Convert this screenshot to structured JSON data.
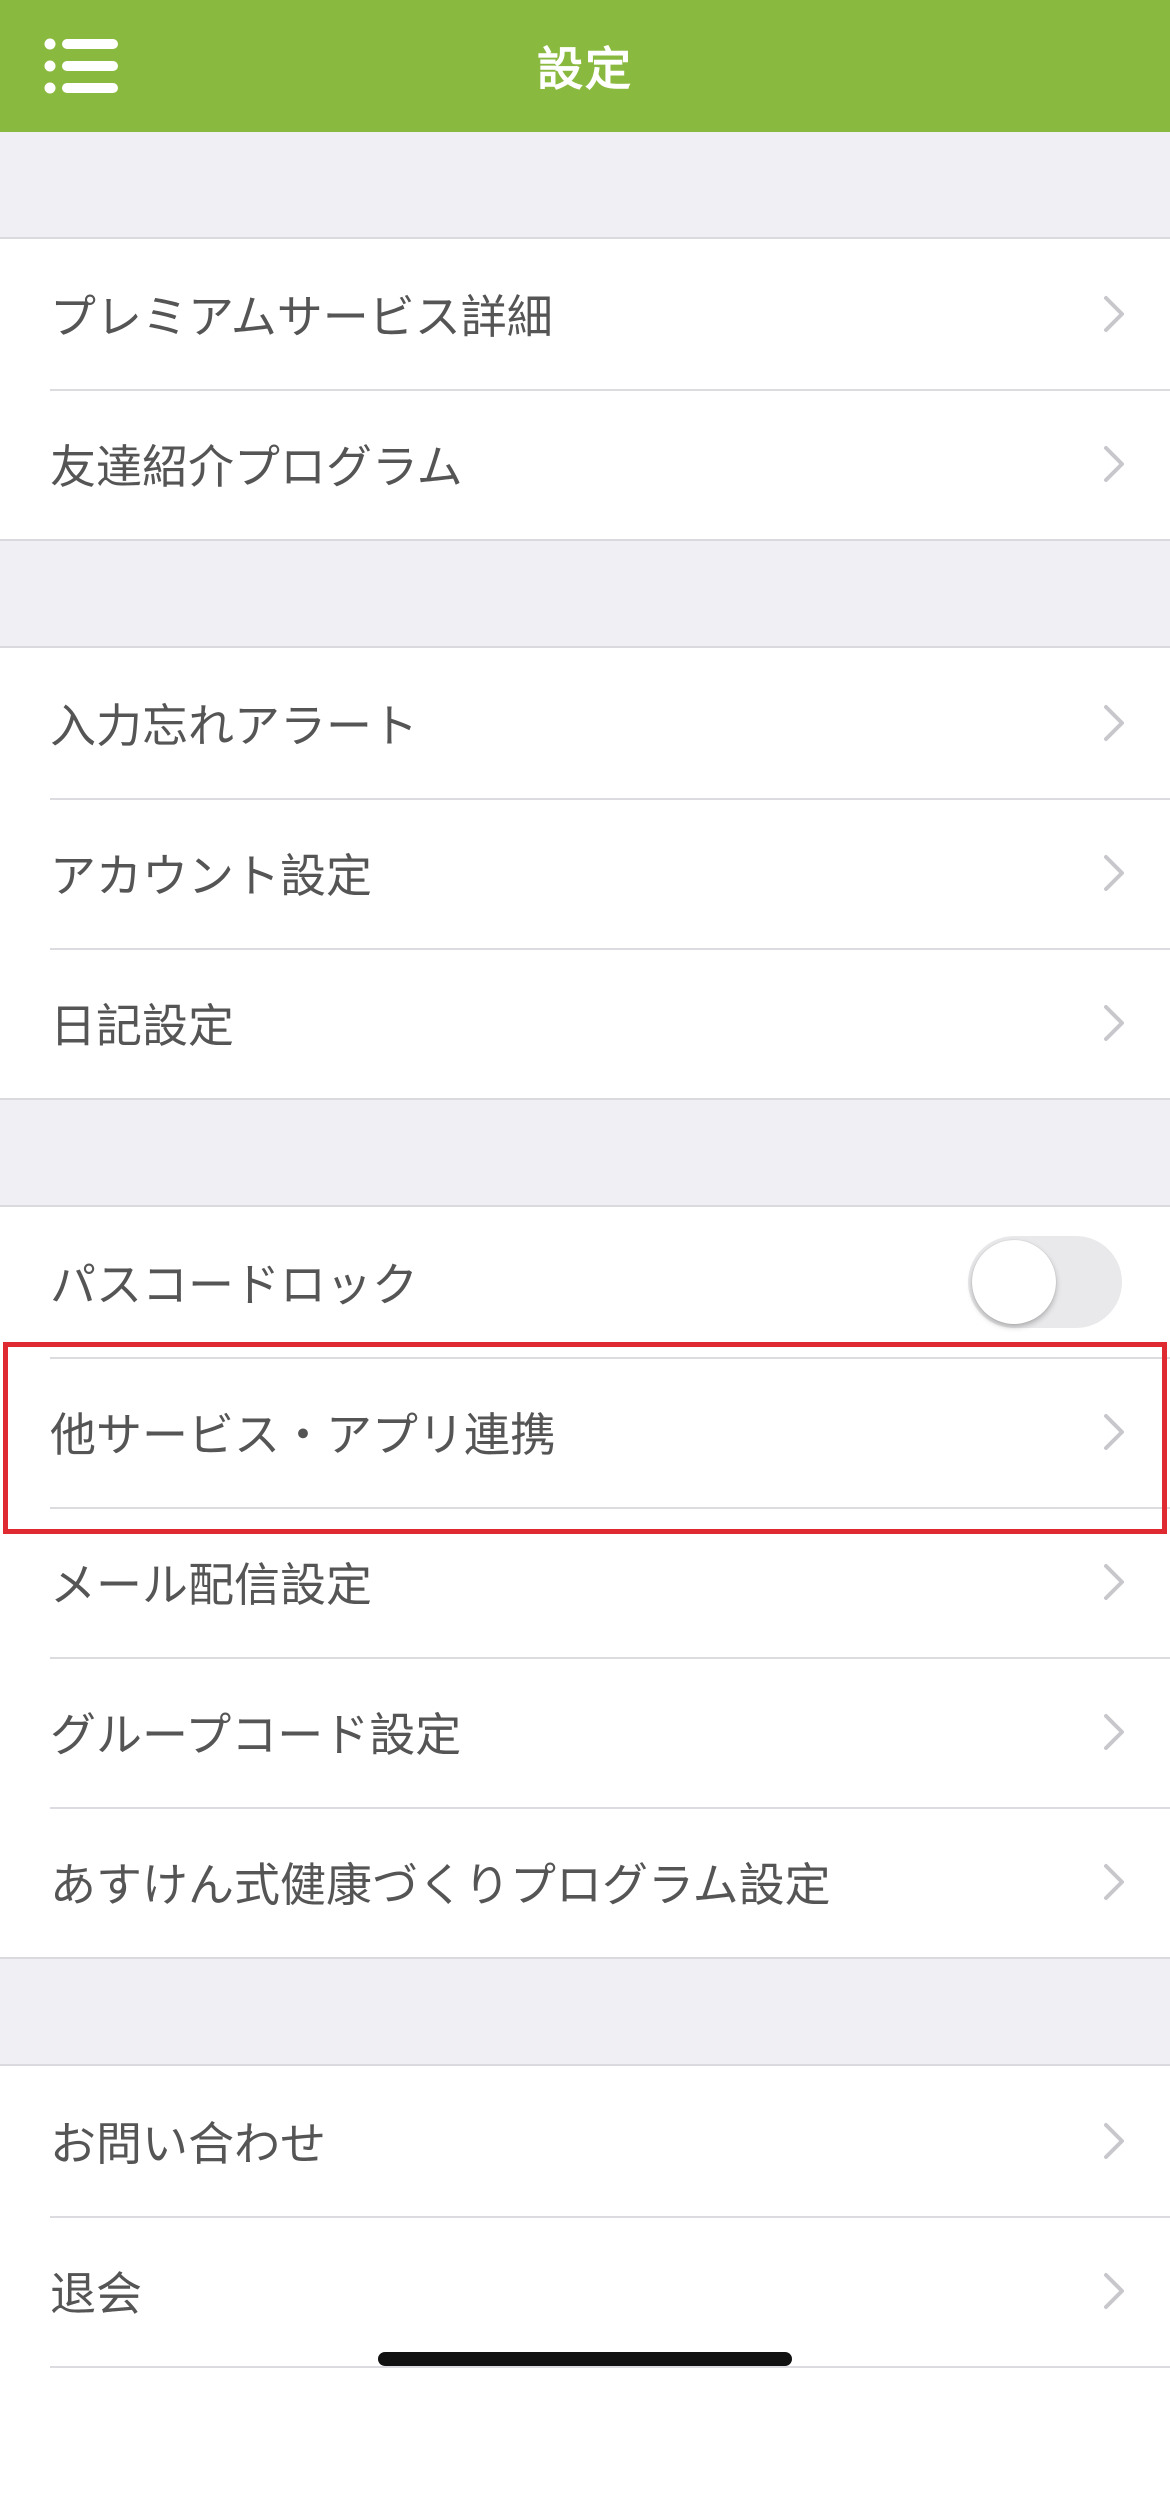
{
  "header": {
    "title": "設定",
    "menu_icon": "list-menu-icon",
    "background_color": "#8ab93f"
  },
  "sections": [
    {
      "items": [
        {
          "label": "プレミアムサービス詳細",
          "accessory": "chevron"
        },
        {
          "label": "友達紹介プログラム",
          "accessory": "chevron"
        }
      ]
    },
    {
      "items": [
        {
          "label": "入力忘れアラート",
          "accessory": "chevron"
        },
        {
          "label": "アカウント設定",
          "accessory": "chevron"
        },
        {
          "label": "日記設定",
          "accessory": "chevron"
        }
      ]
    },
    {
      "items": [
        {
          "label": "パスコードロック",
          "accessory": "toggle",
          "toggle_on": false
        },
        {
          "label": "他サービス・アプリ連携",
          "accessory": "chevron",
          "highlighted": true
        },
        {
          "label": "メール配信設定",
          "accessory": "chevron"
        },
        {
          "label": "グループコード設定",
          "accessory": "chevron"
        },
        {
          "label": "あすけん式健康づくりプログラム設定",
          "accessory": "chevron"
        }
      ]
    },
    {
      "items": [
        {
          "label": "お問い合わせ",
          "accessory": "chevron"
        },
        {
          "label": "退会",
          "accessory": "chevron"
        }
      ]
    }
  ],
  "colors": {
    "highlight_border": "#e02a32",
    "chevron": "#c7c7cc",
    "label_text": "#555555"
  }
}
